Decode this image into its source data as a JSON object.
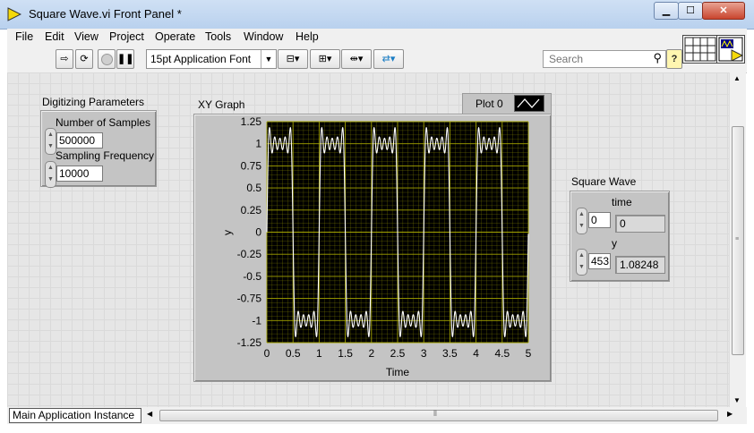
{
  "window": {
    "title": "Square Wave.vi Front Panel *",
    "min": "▁",
    "max": "☐",
    "close": "✕"
  },
  "menu": [
    "File",
    "Edit",
    "View",
    "Project",
    "Operate",
    "Tools",
    "Window",
    "Help"
  ],
  "toolbar": {
    "font_select": "15pt Application Font",
    "search_placeholder": "Search",
    "help": "?"
  },
  "digitizing": {
    "title": "Digitizing Parameters",
    "samples_label": "Number of Samples",
    "samples_value": "500000",
    "freq_label": "Sampling Frequency",
    "freq_value": "10000"
  },
  "graph": {
    "title": "XY Graph",
    "legend_label": "Plot 0"
  },
  "square_wave": {
    "title": "Square Wave",
    "time_label": "time",
    "time_index": "0",
    "time_value": "0",
    "y_label": "y",
    "y_index": "453",
    "y_value": "1.08248"
  },
  "status": {
    "instance": "Main Application Instance"
  },
  "colors": {
    "plot_bg": "#000000",
    "grid": "#a4a400",
    "trace": "#ffffff"
  },
  "chart_data": {
    "type": "line",
    "title": "XY Graph",
    "xlabel": "Time",
    "ylabel": "y",
    "xlim": [
      0,
      5
    ],
    "ylim": [
      -1.25,
      1.25
    ],
    "x_ticks": [
      "0",
      "0.5",
      "1",
      "1.5",
      "2",
      "2.5",
      "3",
      "3.5",
      "4",
      "4.5",
      "5"
    ],
    "y_ticks": [
      "1.25",
      "1",
      "0.75",
      "0.5",
      "0.25",
      "0",
      "-0.25",
      "-0.5",
      "-0.75",
      "-1",
      "-1.25"
    ],
    "series": [
      {
        "name": "Plot 0",
        "period": 1,
        "amplitude": 1,
        "harmonics": [
          1,
          3,
          5,
          7,
          9
        ]
      }
    ],
    "grid": true
  }
}
